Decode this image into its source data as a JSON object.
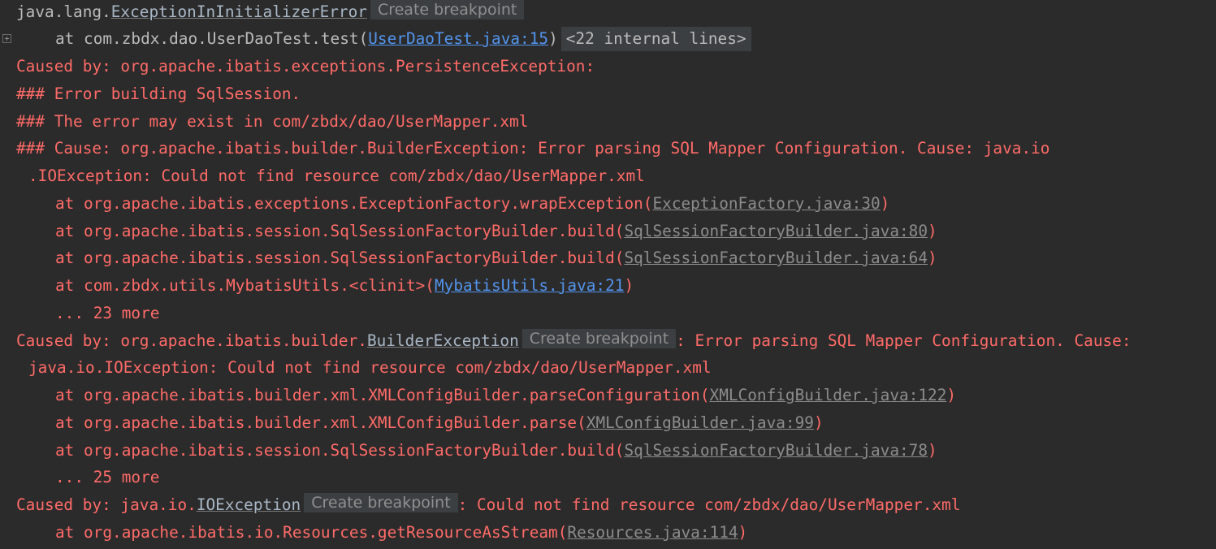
{
  "colors": {
    "background": "#2b2b2b",
    "error_text": "#ff6b68",
    "plain_text": "#bbbbbb",
    "link_blue": "#5394ec",
    "link_gray": "#8c8c8c",
    "chip_bg": "#3c3f41"
  },
  "gutter": {
    "fold_icon": "plus-square-icon"
  },
  "lines": [
    {
      "prefix": "java.lang.",
      "link": "ExceptionInInitializerError",
      "breakpoint": "Create breakpoint"
    },
    {
      "prefix": "at com.zbdx.dao.UserDaoTest.test(",
      "link": "UserDaoTest.java:15",
      "suffix": ")",
      "fold": "<22 internal lines>"
    },
    {
      "text": "Caused by: org.apache.ibatis.exceptions.PersistenceException:"
    },
    {
      "text": "### Error building SqlSession."
    },
    {
      "text": "### The error may exist in com/zbdx/dao/UserMapper.xml"
    },
    {
      "text": "### Cause: org.apache.ibatis.builder.BuilderException: Error parsing SQL Mapper Configuration. Cause: java.io"
    },
    {
      "text": ".IOException: Could not find resource com/zbdx/dao/UserMapper.xml"
    },
    {
      "prefix": "at org.apache.ibatis.exceptions.ExceptionFactory.wrapException(",
      "link": "ExceptionFactory.java:30",
      "suffix": ")"
    },
    {
      "prefix": "at org.apache.ibatis.session.SqlSessionFactoryBuilder.build(",
      "link": "SqlSessionFactoryBuilder.java:80",
      "suffix": ")"
    },
    {
      "prefix": "at org.apache.ibatis.session.SqlSessionFactoryBuilder.build(",
      "link": "SqlSessionFactoryBuilder.java:64",
      "suffix": ")"
    },
    {
      "prefix": "at com.zbdx.utils.MybatisUtils.<clinit>(",
      "link": "MybatisUtils.java:21",
      "suffix": ")"
    },
    {
      "text": "... 23 more"
    },
    {
      "prefix": "Caused by: org.apache.ibatis.builder.",
      "link": "BuilderException",
      "breakpoint": "Create breakpoint",
      "suffix": ": Error parsing SQL Mapper Configuration. Cause:"
    },
    {
      "text": "java.io.IOException: Could not find resource com/zbdx/dao/UserMapper.xml"
    },
    {
      "prefix": "at org.apache.ibatis.builder.xml.XMLConfigBuilder.parseConfiguration(",
      "link": "XMLConfigBuilder.java:122",
      "suffix": ")"
    },
    {
      "prefix": "at org.apache.ibatis.builder.xml.XMLConfigBuilder.parse(",
      "link": "XMLConfigBuilder.java:99",
      "suffix": ")"
    },
    {
      "prefix": "at org.apache.ibatis.session.SqlSessionFactoryBuilder.build(",
      "link": "SqlSessionFactoryBuilder.java:78",
      "suffix": ")"
    },
    {
      "text": "... 25 more"
    },
    {
      "prefix": "Caused by: java.io.",
      "link": "IOException",
      "breakpoint": "Create breakpoint",
      "suffix": ": Could not find resource com/zbdx/dao/UserMapper.xml"
    },
    {
      "prefix": "at org.apache.ibatis.io.Resources.getResourceAsStream(",
      "link": "Resources.java:114",
      "suffix": ")"
    }
  ]
}
